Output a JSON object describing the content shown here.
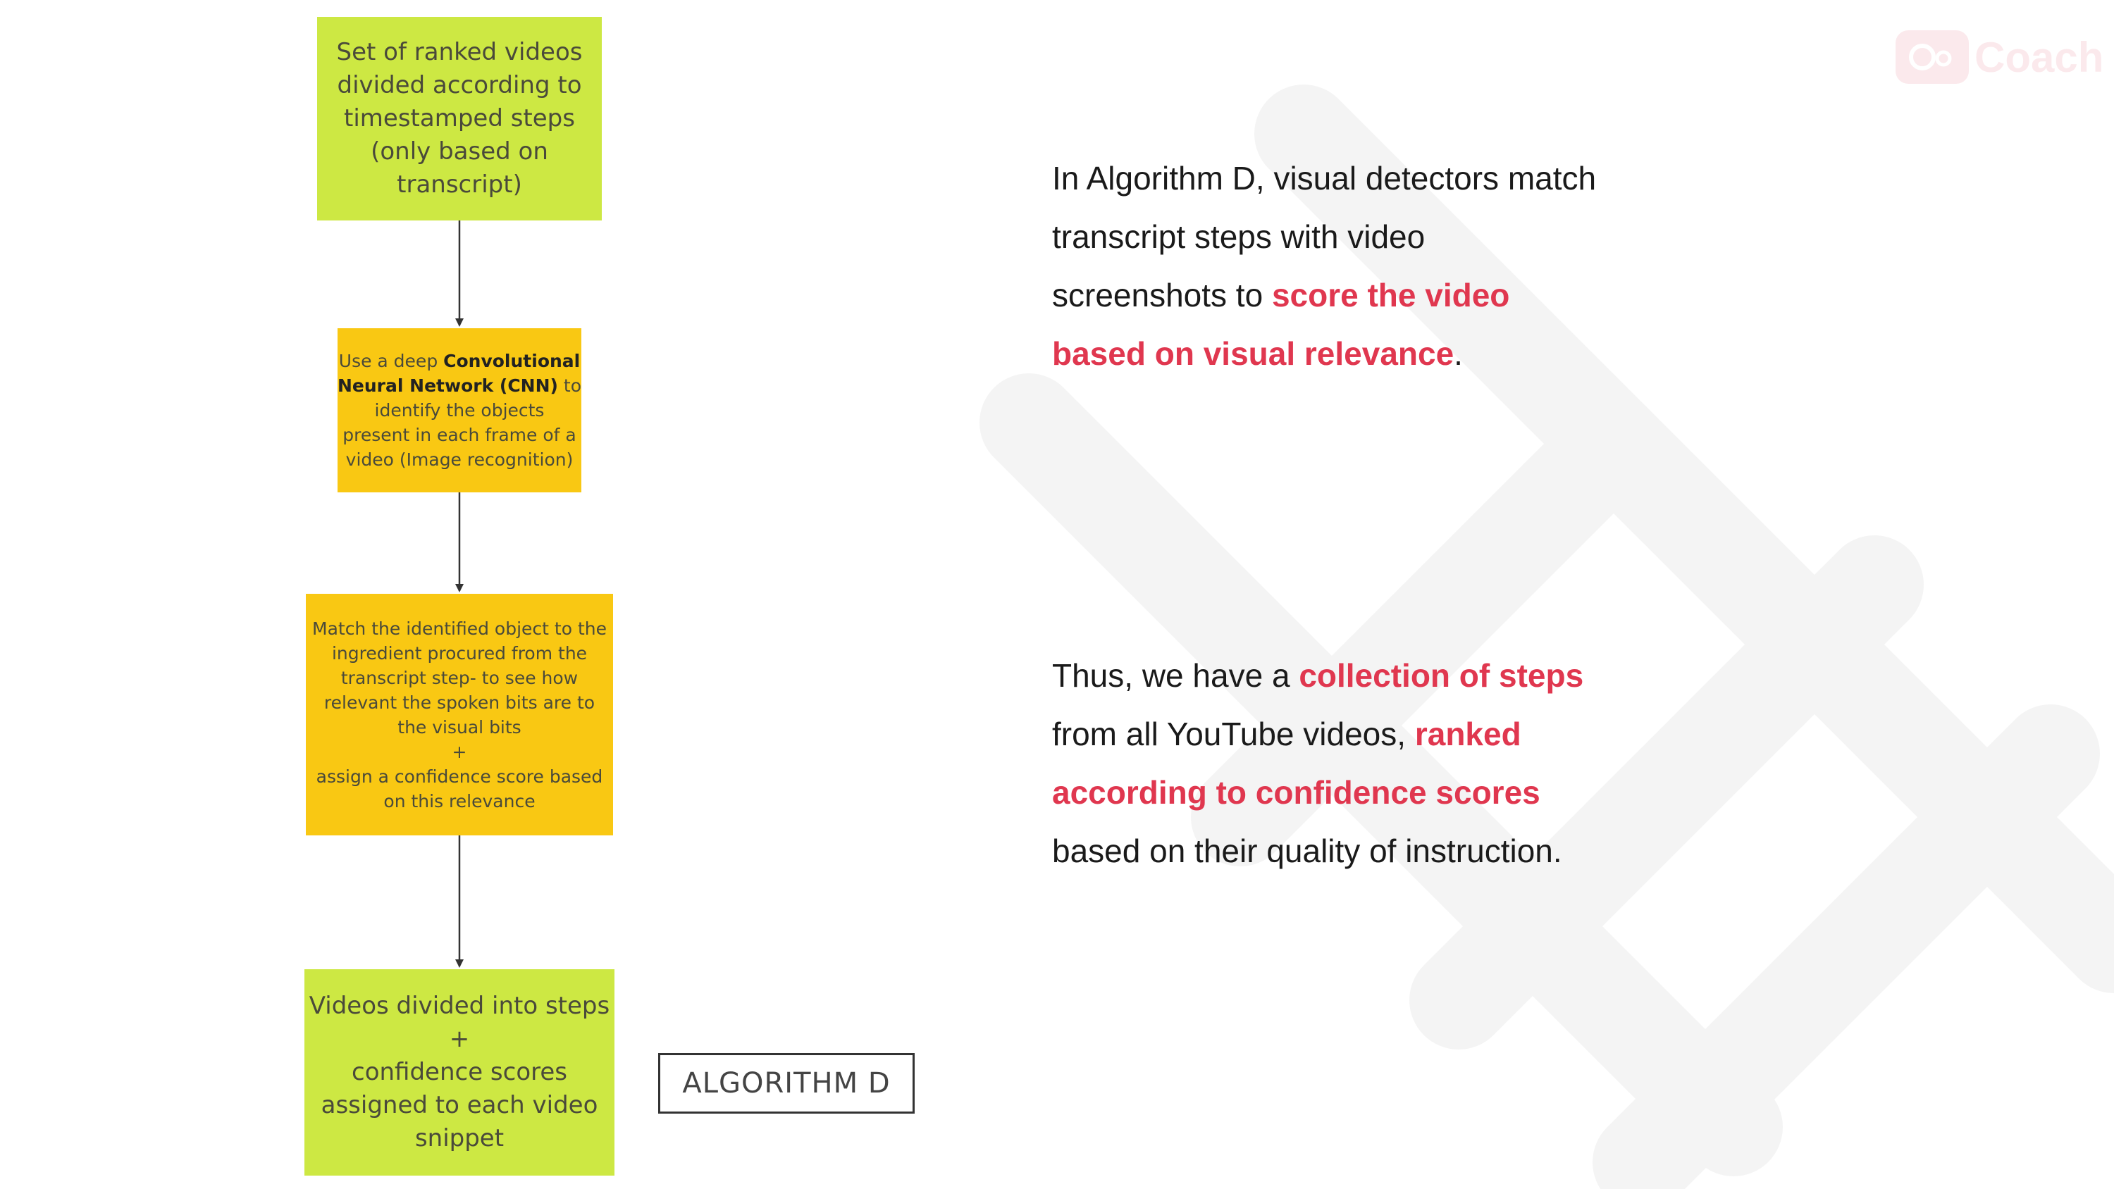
{
  "flowchart": {
    "box1": {
      "lines": [
        "Set of ranked videos",
        "divided according to",
        "timestamped steps",
        "(only based on",
        "transcript)"
      ]
    },
    "box2": {
      "l1_pre": "Use a deep ",
      "l1_bold": "Convolutional",
      "l2_bold": "Neural Network (CNN)",
      "l2_post": " to",
      "lines": [
        "identify the objects",
        "present in each frame of a",
        "video (Image recognition)"
      ]
    },
    "box3": {
      "lines": [
        "Match the identified object to the",
        "ingredient procured from the",
        "transcript step- to see how",
        "relevant the spoken bits are to",
        "the visual bits",
        "+",
        "assign a confidence score based",
        "on this relevance"
      ]
    },
    "box4": {
      "lines": [
        "Videos divided into steps",
        "+",
        "confidence scores",
        "assigned to each video",
        "snippet"
      ]
    }
  },
  "algorithm_label": "ALGORITHM D",
  "paragraph1": {
    "t1": "In Algorithm D, visual detectors match transcript steps with video screenshots to ",
    "h1": "score the video based on visual relevance",
    "t2": "."
  },
  "paragraph2": {
    "t1": "Thus, we have a ",
    "h1": "collection of steps",
    "t2": " from all YouTube videos, ",
    "h2": "ranked according to confidence scores",
    "t3": " based on their quality of instruction."
  },
  "logo": {
    "word": "Coach",
    "icon": "camera-badge-icon"
  },
  "colors": {
    "accent": "#e0374f",
    "green_box": "#cde843",
    "yellow_box": "#f9c813",
    "watermark": "#f4f4f4"
  }
}
